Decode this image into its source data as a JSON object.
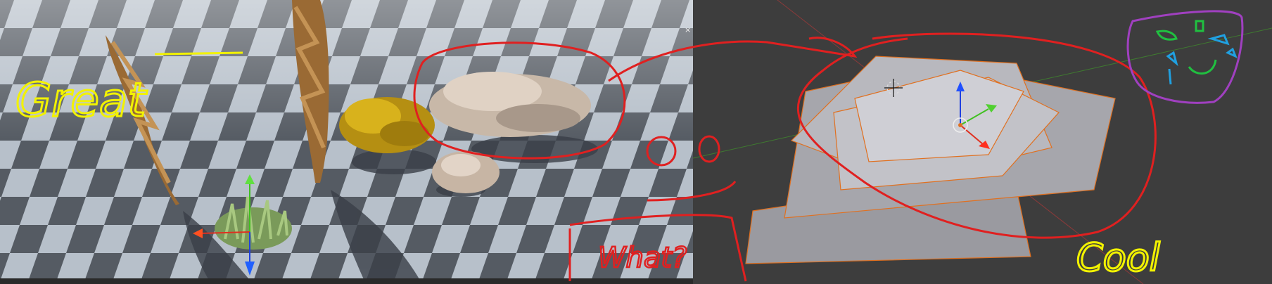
{
  "annotations": {
    "great": "Great",
    "what": "What?",
    "cool": "Cool"
  },
  "status_bar": {
    "item_a": "",
    "item_b": ""
  },
  "colors": {
    "annotation_red": "#e02020",
    "annotation_yellow": "#f2f200",
    "annotation_purple": "#a040c0",
    "annotation_green": "#20c040",
    "annotation_blue": "#20a0e0",
    "gizmo_x": "#e03020",
    "gizmo_y": "#40c020",
    "gizmo_z": "#2040e0",
    "selection_outline": "#e07020"
  },
  "icons": [
    "close-icon",
    "cursor-3d-icon",
    "transform-gizmo-icon",
    "smiley-doodle-icon"
  ]
}
